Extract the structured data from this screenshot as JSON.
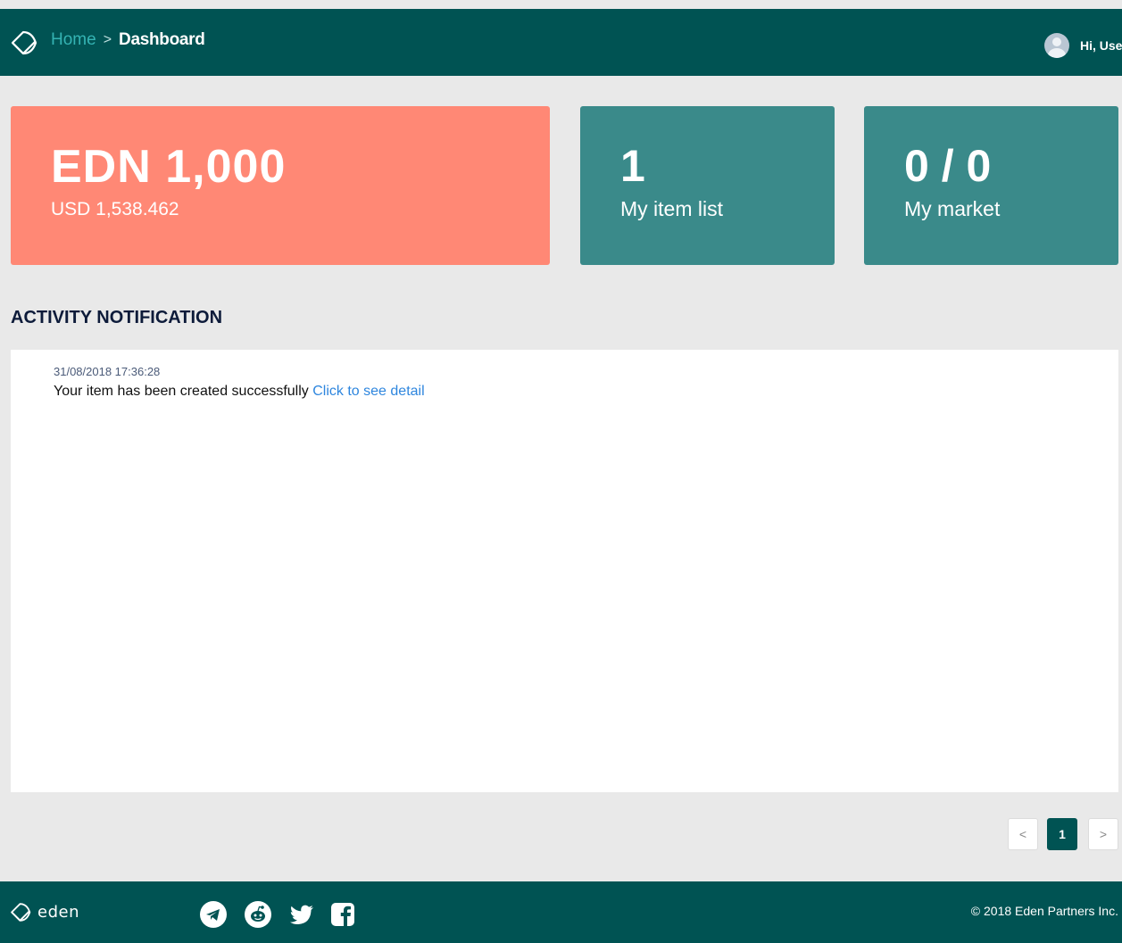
{
  "header": {
    "logo_icon": "eden-logo-icon",
    "breadcrumb": {
      "home": "Home",
      "separator": ">",
      "current": "Dashboard"
    },
    "user_greeting": "Hi, User",
    "avatar_icon": "user-avatar-icon"
  },
  "cards": {
    "balance": {
      "amount": "EDN 1,000",
      "usd": "USD 1,538.462",
      "color": "#ff8875"
    },
    "items": {
      "value": "1",
      "label": "My item list",
      "color": "#3a8a8a"
    },
    "market": {
      "value": "0 / 0",
      "label": "My market",
      "color": "#3a8a8a"
    }
  },
  "activity": {
    "title": "ACTIVITY NOTIFICATION",
    "items": [
      {
        "time": "31/08/2018 17:36:28",
        "text": "Your item has been created successfully",
        "link": "Click to see detail"
      }
    ]
  },
  "pagination": {
    "prev": "<",
    "current": "1",
    "next": ">"
  },
  "footer": {
    "brand": "eden",
    "social_icons": [
      "telegram-icon",
      "reddit-icon",
      "twitter-icon",
      "facebook-icon"
    ],
    "copyright": "© 2018 Eden Partners Inc."
  },
  "colors": {
    "primary": "#005353",
    "accent": "#34b3b3",
    "balance": "#ff8875",
    "tile": "#3a8a8a",
    "link": "#2e86de"
  }
}
